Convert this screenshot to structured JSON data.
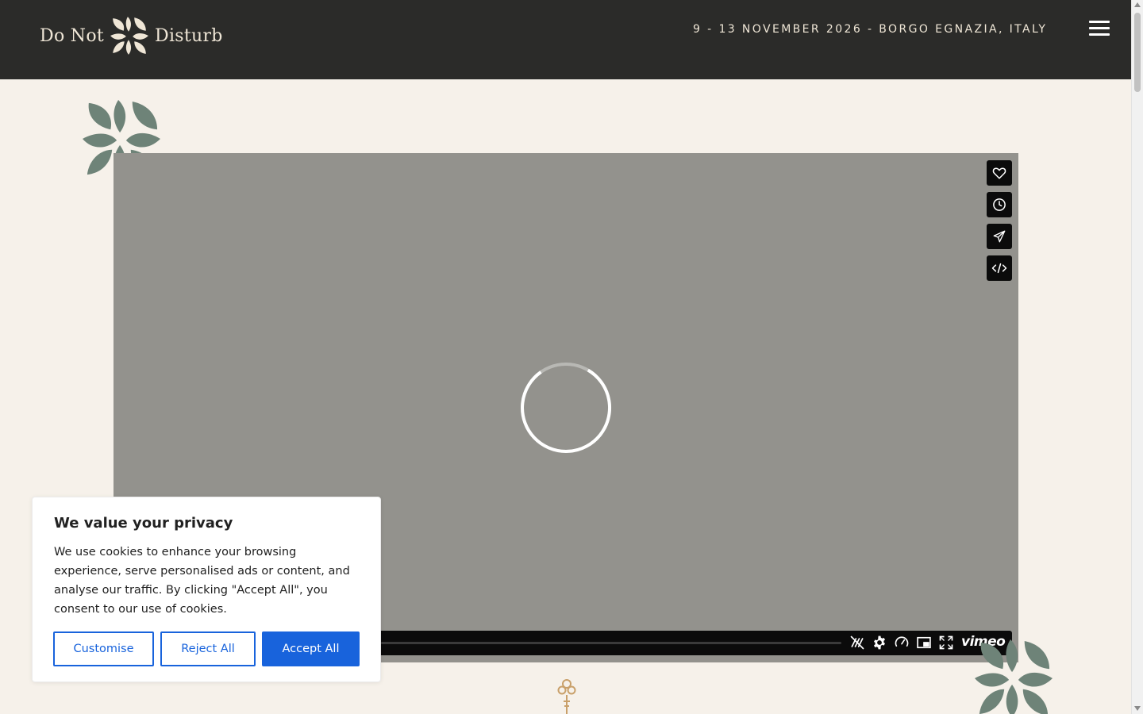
{
  "header": {
    "logo_left": "Do Not",
    "logo_right": "Disturb",
    "date_location": "9 - 13 NOVEMBER 2026 - BORGO EGNAZIA, ITALY",
    "menu_icon": "hamburger-menu-icon"
  },
  "video": {
    "side_buttons": [
      "heart-icon",
      "clock-icon",
      "send-icon",
      "embed-code-icon"
    ],
    "control_icons": [
      "captions-off-icon",
      "gear-icon",
      "speed-icon",
      "picture-in-picture-icon",
      "fullscreen-icon"
    ],
    "brand": "vimeo",
    "state": "loading"
  },
  "cookie_banner": {
    "title": "We value your privacy",
    "body": "We use cookies to enhance your browsing experience, serve personalised ads or content, and analyse our traffic. By clicking \"Accept All\", you consent to our use of cookies.",
    "customise_label": "Customise",
    "reject_label": "Reject All",
    "accept_label": "Accept All",
    "accent_color": "#1863dc"
  },
  "colors": {
    "header_bg": "#2b2b29",
    "page_bg": "#f6f1ea",
    "leaf_green": "#6e8378",
    "cream": "#efe6d6"
  }
}
